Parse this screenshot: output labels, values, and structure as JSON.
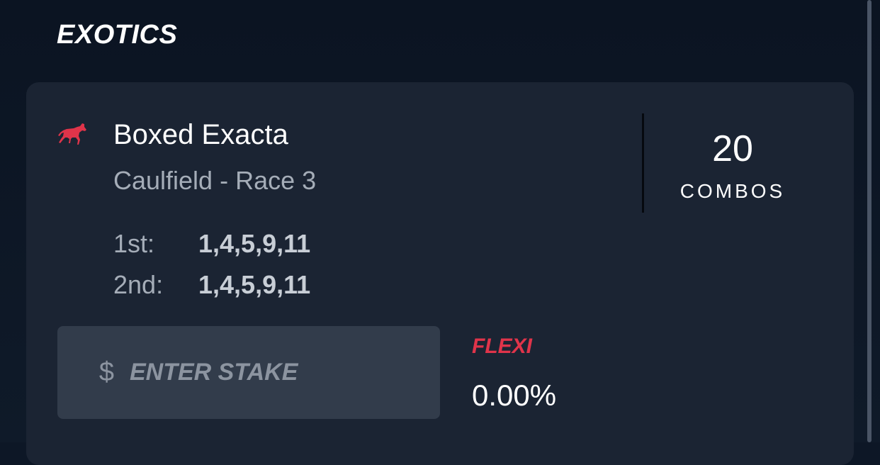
{
  "section": {
    "title": "EXOTICS"
  },
  "bet": {
    "icon": "horse-racing-icon",
    "title": "Boxed Exacta",
    "subtitle": "Caulfield - Race 3",
    "combos": {
      "count": "20",
      "label": "COMBOS"
    },
    "selections": [
      {
        "label": "1st:",
        "value": "1,4,5,9,11"
      },
      {
        "label": "2nd:",
        "value": "1,4,5,9,11"
      }
    ],
    "stake": {
      "currency_symbol": "$",
      "placeholder": "ENTER STAKE",
      "value": ""
    },
    "flexi": {
      "label": "FLEXI",
      "value": "0.00%"
    }
  },
  "colors": {
    "background": "#0d1726",
    "card": "#1b2433",
    "input": "#323c4b",
    "accent": "#e0344a",
    "muted_text": "#a5adb8",
    "primary_text": "#ffffff"
  }
}
